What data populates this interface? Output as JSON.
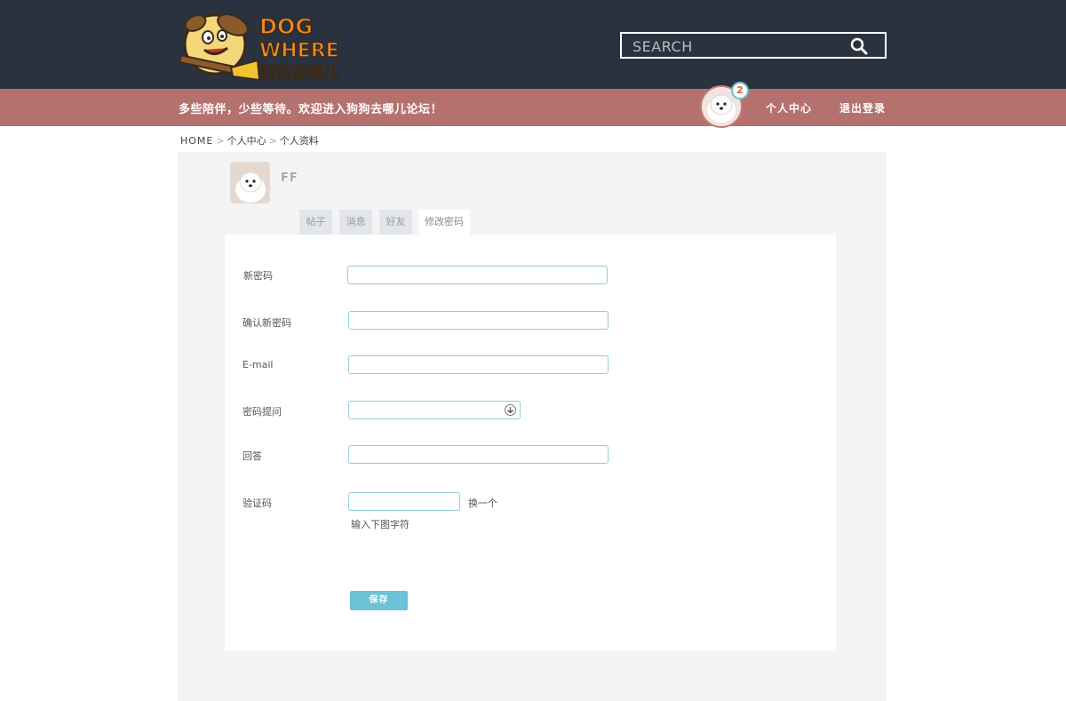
{
  "header": {
    "logo_text_1": "DOG",
    "logo_text_2": "WHERE",
    "logo_text_3": "狗狗去哪儿",
    "search_placeholder": "SEARCH"
  },
  "bar": {
    "slogan": "多些陪伴，少些等待。欢迎进入狗狗去哪儿论坛！",
    "notification_count": "2",
    "nav": {
      "profile_center": "个人中心",
      "logout": "退出登录"
    }
  },
  "breadcrumb": {
    "home": "HOME",
    "sep": ">",
    "level1": "个人中心",
    "level2": "个人资料"
  },
  "profile": {
    "username": "FF"
  },
  "tabs": [
    {
      "label": "帖子"
    },
    {
      "label": "消息"
    },
    {
      "label": "好友"
    },
    {
      "label": "修改密码"
    }
  ],
  "form": {
    "new_password_label": "新密码",
    "confirm_password_label": "确认新密码",
    "email_label": "E-mail",
    "question_label": "密码提问",
    "answer_label": "回答",
    "captcha_label": "验证码",
    "captcha_refresh": "换一个",
    "captcha_hint": "输入下图字符",
    "save_label": "保存"
  },
  "colors": {
    "header_bg": "#2b323f",
    "bar_bg": "#b5716d",
    "accent": "#6cc3d6",
    "panel_bg": "#f4f4f4"
  }
}
